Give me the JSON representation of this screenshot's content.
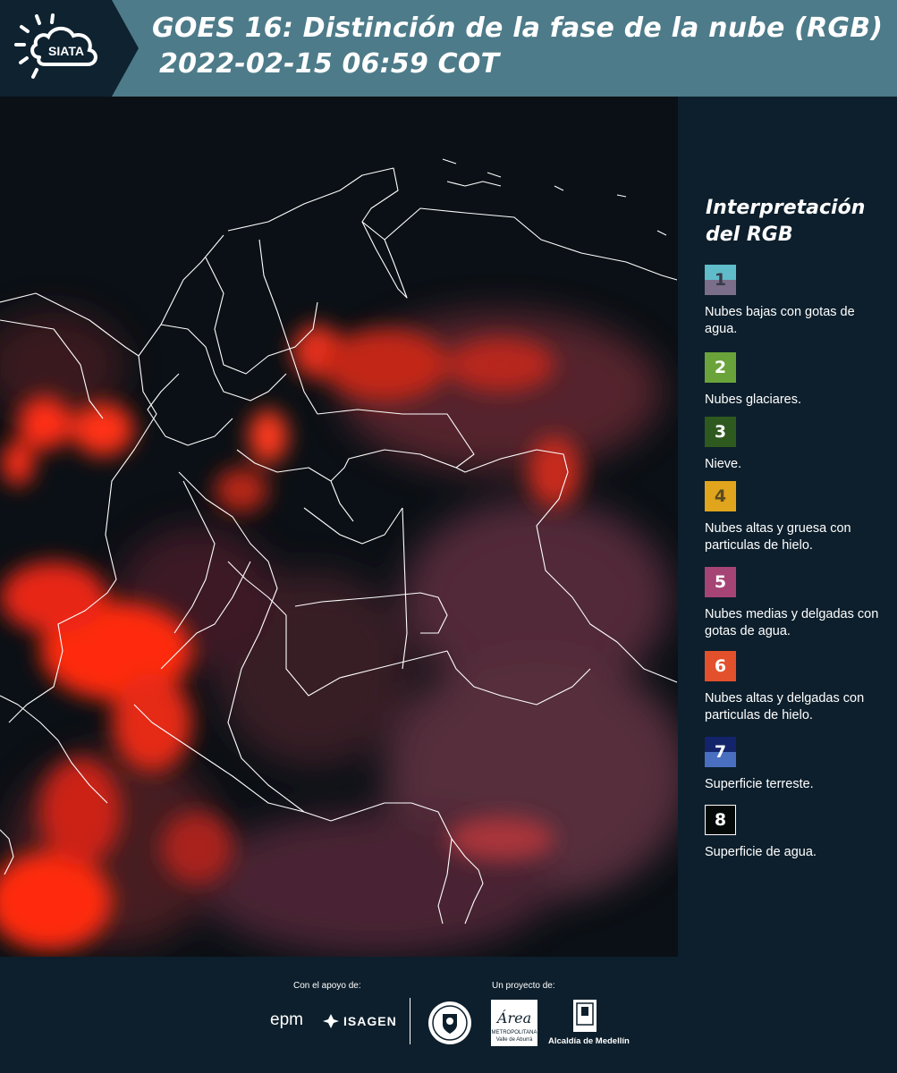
{
  "header": {
    "logo_text": "SIATA",
    "title_line1": "GOES 16: Distinción de la fase de la nube (RGB)",
    "title_line2": "2022-02-15 06:59 COT"
  },
  "legend": {
    "title": "Interpretación del RGB",
    "items": [
      {
        "number": "1",
        "label": "Nubes bajas con gotas de agua.",
        "color_top": "#5fbcc8",
        "color_bottom": "#7a6e8a",
        "num_color": "#3a3a4a"
      },
      {
        "number": "2",
        "label": "Nubes glaciares.",
        "color_top": "#6aa33a",
        "color_bottom": "#6aa33a",
        "num_color": "#ffffff"
      },
      {
        "number": "3",
        "label": "Nieve.",
        "color_top": "#2f5a1f",
        "color_bottom": "#2f5a1f",
        "num_color": "#ffffff"
      },
      {
        "number": "4",
        "label": "Nubes altas y gruesa con particulas de hielo.",
        "color_top": "#e0a51c",
        "color_bottom": "#e0a51c",
        "num_color": "#5a4a20"
      },
      {
        "number": "5",
        "label": "Nubes medias y delgadas con gotas de agua.",
        "color_top": "#a64476",
        "color_bottom": "#a64476",
        "num_color": "#ffffff"
      },
      {
        "number": "6",
        "label": "Nubes altas y delgadas con particulas de hielo.",
        "color_top": "#e3502c",
        "color_bottom": "#e3502c",
        "num_color": "#ffffff"
      },
      {
        "number": "7",
        "label": "Superficie terreste.",
        "color_top": "#13246b",
        "color_bottom": "#4a6fc0",
        "num_color": "#ffffff"
      },
      {
        "number": "8",
        "label": "Superficie de agua.",
        "color_top": "#050a08",
        "color_bottom": "#050a08",
        "num_color": "#ffffff"
      }
    ]
  },
  "footer": {
    "support_label": "Con el apoyo de:",
    "project_label": "Un proyecto de:",
    "epm": "epm",
    "isagen": "ISAGEN",
    "area_text": "Área",
    "area_sub1": "METROPOLITANA",
    "area_sub2": "Valle de Aburrá",
    "alcaldia": "Alcaldía de Medellín"
  },
  "colors": {
    "header_bg": "#4d7b89",
    "panel_bg": "#0d1f2c",
    "cloud_red": "#ff2a10",
    "cloud_pink": "#b04f5c",
    "borders": "#ffffff"
  }
}
